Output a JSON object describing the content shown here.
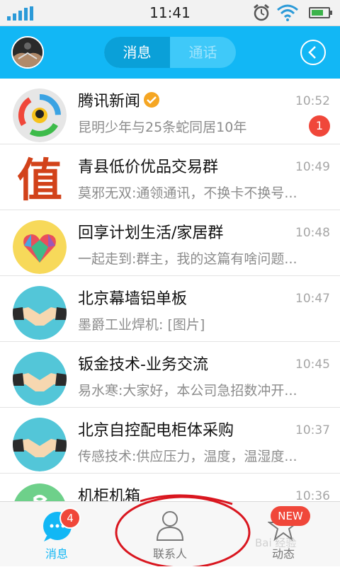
{
  "status_bar": {
    "time": "11:41",
    "battery_level": 0.6
  },
  "header": {
    "tabs": [
      {
        "label": "消息",
        "active": true
      },
      {
        "label": "通话",
        "active": false
      }
    ]
  },
  "conversations": [
    {
      "name": "腾讯新闻",
      "verified": true,
      "time": "10:52",
      "preview": "昆明少年与25条蛇同居10年",
      "unread": "1",
      "avatar": "tencent-news-logo"
    },
    {
      "name": "青县低价优品交易群",
      "time": "10:49",
      "preview": "莫邪无双:通领通讯，不换卡不换号...",
      "avatar": "zhi-character-logo",
      "avatar_text": "值"
    },
    {
      "name": "回享计划生活/家居群",
      "time": "10:48",
      "preview": "一起走到:群主，我的这篇有啥问题...",
      "avatar": "colorful-heart-logo"
    },
    {
      "name": "北京幕墙铝单板",
      "time": "10:47",
      "preview": "墨爵工业焊机: [图片]",
      "avatar": "handshake-group-avatar"
    },
    {
      "name": "钣金技术-业务交流",
      "time": "10:45",
      "preview": "易水寒:大家好，本公司急招数冲开...",
      "avatar": "handshake-group-avatar"
    },
    {
      "name": "北京自控配电柜体采购",
      "time": "10:37",
      "preview": "传感技术:供应压力，温度，温湿度...",
      "avatar": "handshake-group-avatar"
    },
    {
      "name": "机柜机箱",
      "time": "10:36",
      "preview": "",
      "avatar": "green-group-avatar"
    }
  ],
  "tab_bar": {
    "items": [
      {
        "label": "消息",
        "badge": "4",
        "icon": "chat-bubble-icon",
        "active": true
      },
      {
        "label": "联系人",
        "icon": "contact-person-icon",
        "active": false
      },
      {
        "label": "动态",
        "badge": "NEW",
        "icon": "star-icon",
        "active": false
      }
    ]
  },
  "watermark": "Bai 经验",
  "colors": {
    "header": "#12b7f5",
    "badge": "#f0473a",
    "annotation": "#d9161f"
  }
}
